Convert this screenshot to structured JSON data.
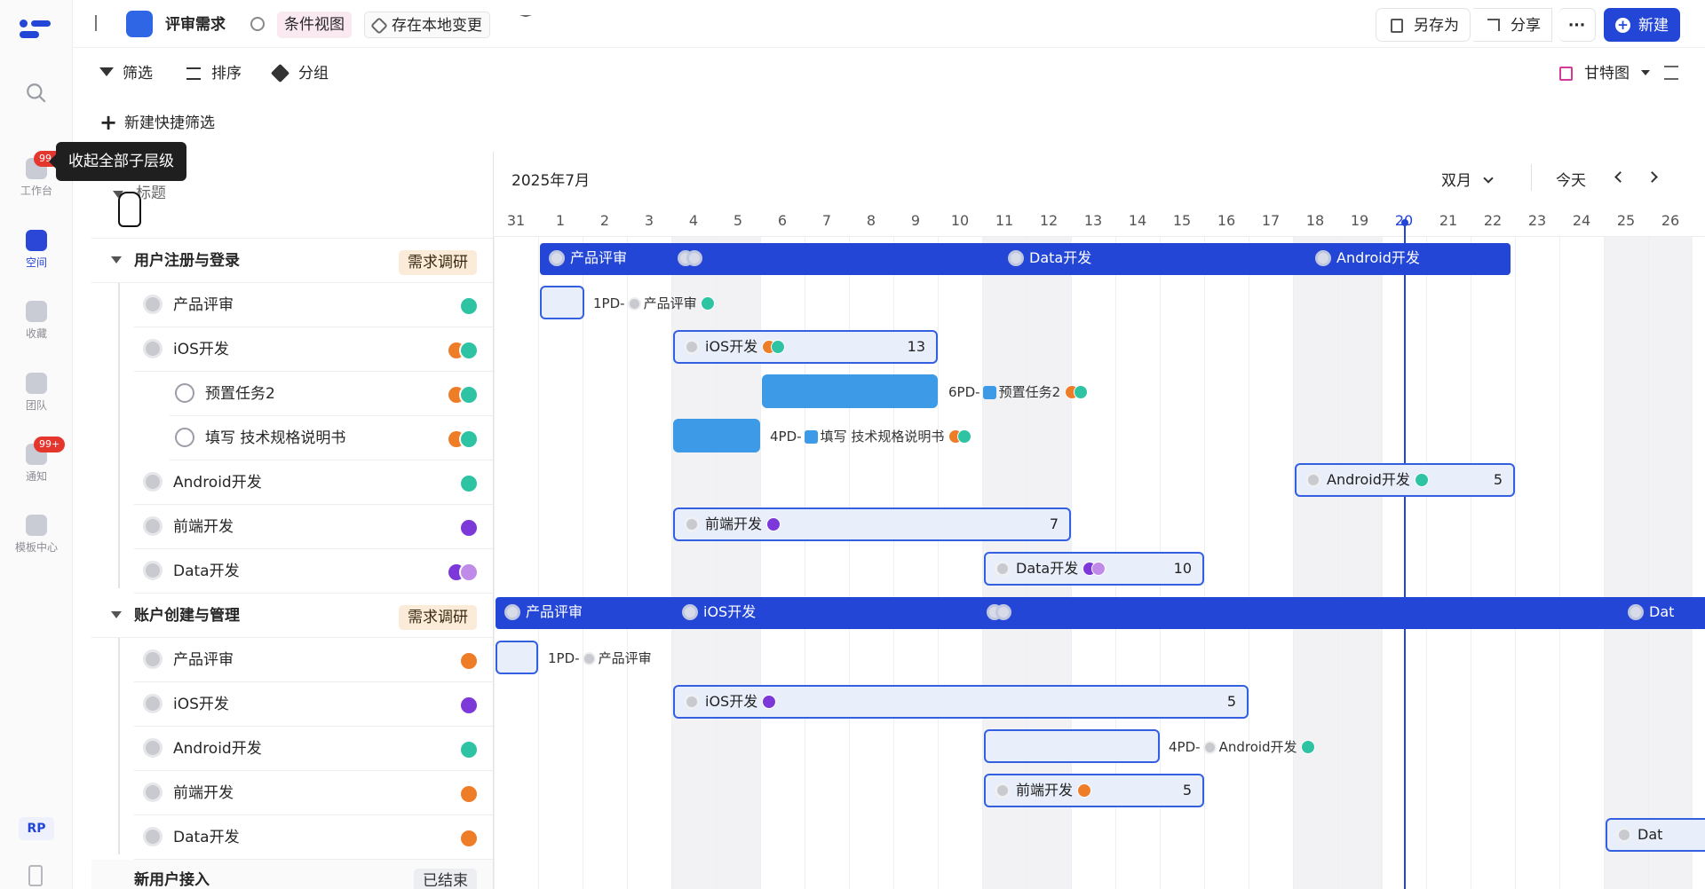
{
  "rail": {
    "items": [
      {
        "label": "",
        "icon": "search-icon"
      },
      {
        "label": "工作台",
        "icon": "home-icon",
        "badge": "99+"
      },
      {
        "label": "空间",
        "icon": "space-icon"
      },
      {
        "label": "收藏",
        "icon": "star-icon"
      },
      {
        "label": "团队",
        "icon": "team-icon"
      },
      {
        "label": "通知",
        "icon": "bell-icon",
        "badge": "99+"
      },
      {
        "label": "模板中心",
        "icon": "template-icon"
      }
    ],
    "user": "RP"
  },
  "topbar": {
    "title": "评审需求",
    "view": "条件视图",
    "save_local": "存在本地变更",
    "save_as": "另存为",
    "share": "分享",
    "new": "新建"
  },
  "toolbar": {
    "filter": "筛选",
    "sort": "排序",
    "group": "分组",
    "view_mode": "甘特图",
    "new_filter": "新建快捷筛选"
  },
  "tooltip": "收起全部子层级",
  "tree": {
    "header": "标题",
    "groups": [
      {
        "title": "用户注册与登录",
        "tag": "需求调研",
        "items": [
          {
            "title": "产品评审",
            "sub": false
          },
          {
            "title": "iOS开发",
            "sub": false
          },
          {
            "title": "预置任务2",
            "sub": true
          },
          {
            "title": "填写 技术规格说明书",
            "sub": true
          },
          {
            "title": "Android开发",
            "sub": false
          },
          {
            "title": "前端开发",
            "sub": false
          },
          {
            "title": "Data开发",
            "sub": false
          }
        ]
      },
      {
        "title": "账户创建与管理",
        "tag": "需求调研",
        "items": [
          {
            "title": "产品评审"
          },
          {
            "title": "iOS开发"
          },
          {
            "title": "Android开发"
          },
          {
            "title": "前端开发"
          },
          {
            "title": "Data开发"
          }
        ]
      },
      {
        "title": "新用户接入",
        "tag": "已结束"
      }
    ]
  },
  "gantt": {
    "month": "2025年7月",
    "scale": "双月",
    "today": "今天",
    "days": [
      "31",
      "1",
      "2",
      "3",
      "4",
      "5",
      "6",
      "7",
      "8",
      "9",
      "10",
      "11",
      "12",
      "13",
      "14",
      "15",
      "16",
      "17",
      "18",
      "19",
      "20",
      "21",
      "22",
      "23",
      "24",
      "25",
      "26"
    ],
    "bars": {
      "g1_sum": [
        "产品评审",
        "Data开发",
        "Android开发"
      ],
      "ios_n": "13",
      "android_n": "5",
      "fe_n": "7",
      "data_n": "10",
      "g2_sum": [
        "产品评审",
        "iOS开发",
        "Dat"
      ],
      "g2_ios_n": "5",
      "g2_fe_n": "5"
    },
    "ext": {
      "pd1": "1PD-",
      "pr": "产品评审",
      "pd6": "6PD-",
      "t2": "预置任务2",
      "pd4": "4PD-",
      "spec": "填写 技术规格说明书",
      "android": "Android开发"
    }
  }
}
